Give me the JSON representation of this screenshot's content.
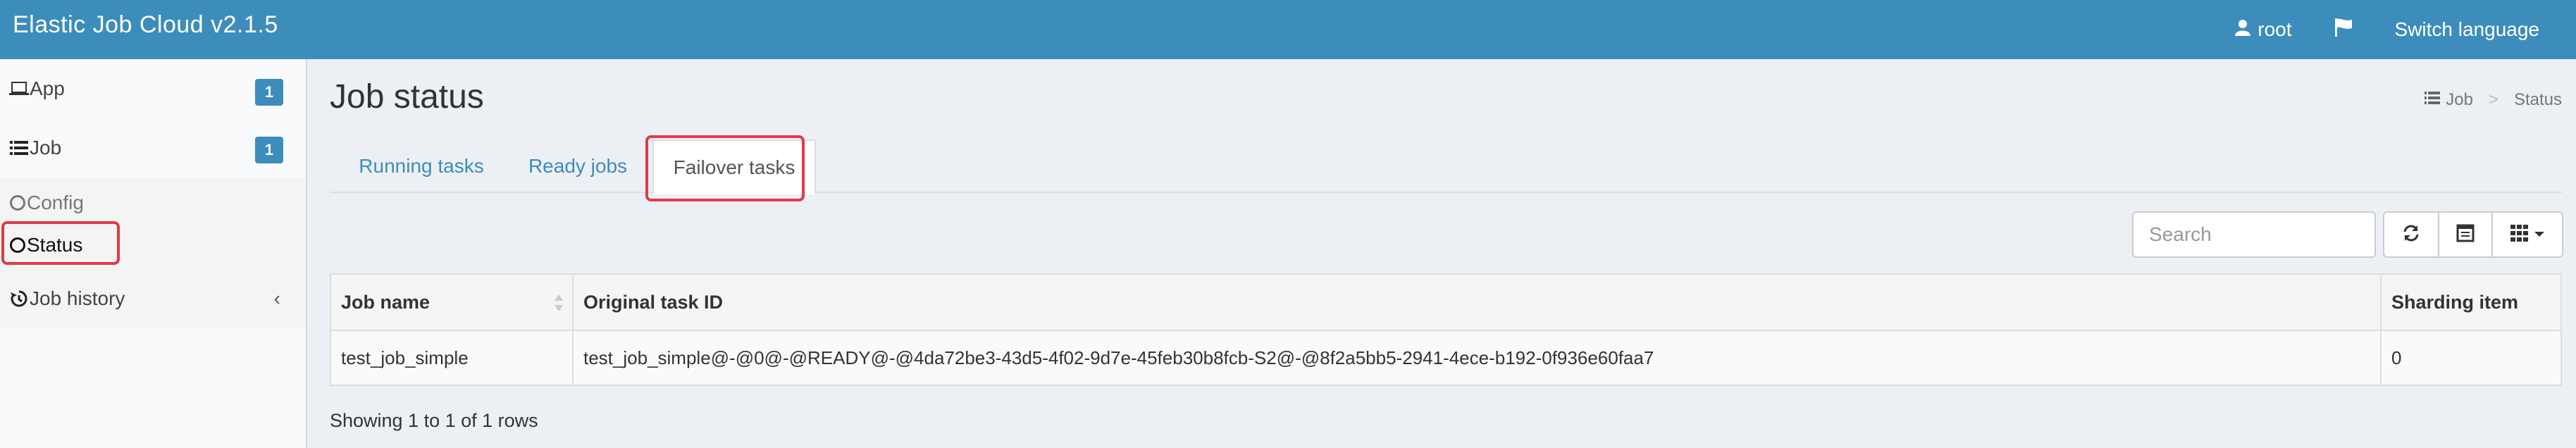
{
  "header": {
    "brand": "Elastic Job Cloud v2.1.5",
    "user_label": "root",
    "language_label": "Switch language",
    "user_icon": "user-icon",
    "flag_icon": "flag-icon"
  },
  "sidebar": {
    "app_label": "App",
    "app_badge": "1",
    "job_label": "Job",
    "job_badge": "1",
    "config_label": "Config",
    "status_label": "Status",
    "history_label": "Job history"
  },
  "main": {
    "title": "Job status",
    "breadcrumb": [
      "Job",
      "Status"
    ],
    "tabs": [
      "Running tasks",
      "Ready jobs",
      "Failover tasks"
    ],
    "active_tab": "Failover tasks",
    "search_placeholder": "Search",
    "table": {
      "columns": [
        "Job name",
        "Original task ID",
        "Sharding item"
      ],
      "rows": [
        [
          "test_job_simple",
          "test_job_simple@-@0@-@READY@-@4da72be3-43d5-4f02-9d7e-45feb30b8fcb-S2@-@8f2a5bb5-2941-4ece-b192-0f936e60faa7",
          "0"
        ]
      ]
    },
    "pagination_info": "Showing 1 to 1 of 1 rows"
  },
  "colors": {
    "accent": "#3c8dbc",
    "highlight": "#e03a4a"
  }
}
